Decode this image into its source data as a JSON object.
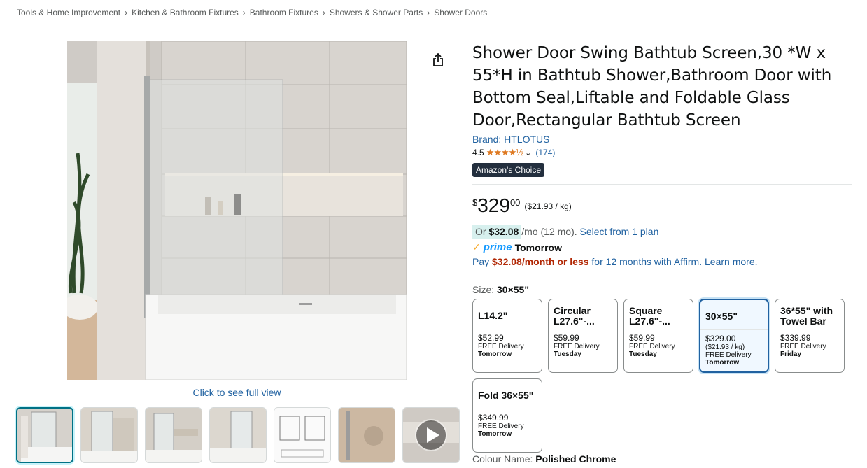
{
  "breadcrumb": [
    "Tools & Home Improvement",
    "Kitchen & Bathroom Fixtures",
    "Bathroom Fixtures",
    "Showers & Shower Parts",
    "Shower Doors"
  ],
  "image": {
    "full_view_label": "Click to see full view"
  },
  "product": {
    "title": "Shower Door Swing Bathtub Screen,30 *W x 55*H in Bathtub Shower,Bathroom Door with Bottom Seal,Liftable and Foldable Glass Door,Rectangular Bathtub Screen",
    "brand": "Brand: HTLOTUS",
    "rating": "4.5",
    "rating_count": "(174)",
    "badge": "Amazon's Choice",
    "price_symbol": "$",
    "price_whole": "329",
    "price_fraction": "00",
    "unit_price": "($21.93 / kg)",
    "monthly_or": "Or",
    "monthly_amount": "$32.08",
    "monthly_rest": "/mo (12 mo).",
    "monthly_link": "Select from 1 plan",
    "prime_label": "prime",
    "prime_delivery": "Tomorrow",
    "affirm_pay": "Pay",
    "affirm_amount": "$32.08/month or less",
    "affirm_rest": "for 12 months with Affirm.",
    "affirm_link": "Learn more.",
    "size_label": "Size:",
    "size_value": "30×55\"",
    "colour_label": "Colour Name:",
    "colour_value": "Polished Chrome"
  },
  "swatches": [
    {
      "name": "L14.2\"",
      "price": "$52.99",
      "unit": "",
      "delivery": "FREE Delivery",
      "day": "Tomorrow"
    },
    {
      "name": "Circular L27.6\"-...",
      "price": "$59.99",
      "unit": "",
      "delivery": "FREE Delivery",
      "day": "Tuesday"
    },
    {
      "name": "Square L27.6\"-...",
      "price": "$59.99",
      "unit": "",
      "delivery": "FREE Delivery",
      "day": "Tuesday"
    },
    {
      "name": "30×55\"",
      "price": "$329.00",
      "unit": "($21.93 / kg)",
      "delivery": "FREE Delivery",
      "day": "Tomorrow"
    },
    {
      "name": "36*55\" with Towel Bar",
      "price": "$339.99",
      "unit": "",
      "delivery": "FREE Delivery",
      "day": "Friday"
    },
    {
      "name": "Fold 36×55\"",
      "price": "$349.99",
      "unit": "",
      "delivery": "FREE Delivery",
      "day": "Tomorrow"
    }
  ],
  "colors": {
    "link": "#2162a1",
    "star": "#de7921",
    "price_red": "#b12704",
    "selected_border": "#2162a1"
  }
}
